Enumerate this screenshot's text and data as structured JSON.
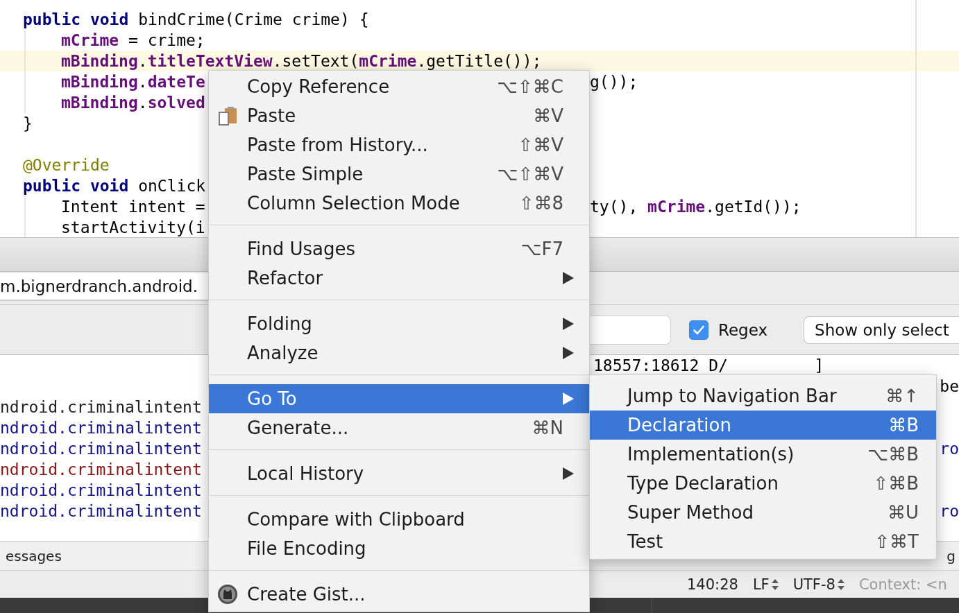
{
  "editor": {
    "blocks": [
      {
        "lines": [
          {
            "tokens": [
              {
                "kind": "keyword",
                "text": "public void",
                "suffix": " bindCrime(Crime crime) {"
              }
            ],
            "current": false,
            "children": [
              {
                "tokens": [
                  {
                    "kind": "field",
                    "text": "mCrime",
                    "suffix": " = crime;"
                  }
                ],
                "current": false
              },
              {
                "tokens": [
                  {
                    "kind": "field",
                    "text": "mBinding",
                    "suffix": "."
                  },
                  {
                    "kind": "field",
                    "text": "titleTextView",
                    "suffix": ".setText("
                  },
                  {
                    "kind": "field",
                    "text": "mCrime",
                    "suffix": ".getTitle());"
                  }
                ],
                "current": true
              },
              {
                "tokens": [
                  {
                    "kind": "field",
                    "text": "mBinding",
                    "suffix": "."
                  },
                  {
                    "kind": "field",
                    "text": "dateTe"
                  }
                ],
                "tokens_right": [
                  {
                    "kind": "plain",
                    "text": "g());"
                  }
                ],
                "current": false
              },
              {
                "tokens": [
                  {
                    "kind": "field",
                    "text": "mBinding",
                    "suffix": "."
                  },
                  {
                    "kind": "field",
                    "text": "solved"
                  }
                ],
                "current": false
              }
            ]
          },
          {
            "tokens": [
              {
                "kind": "plain",
                "text": "}"
              }
            ],
            "current": false
          }
        ]
      },
      {
        "lines": [
          {
            "tokens": [
              {
                "kind": "annotation",
                "text": "@Override"
              }
            ],
            "current": false
          },
          {
            "tokens": [
              {
                "kind": "keyword",
                "text": "public void",
                "suffix": " onClick"
              }
            ],
            "current": false,
            "children": [
              {
                "tokens": [
                  {
                    "kind": "plain",
                    "text": "Intent intent ="
                  }
                ],
                "tokens_right": [
                  {
                    "kind": "plain",
                    "text": "ty(), "
                  },
                  {
                    "kind": "field",
                    "text": "mCrime",
                    "suffix": ".getId());"
                  }
                ],
                "current": false
              },
              {
                "tokens": [
                  {
                    "kind": "plain",
                    "text": "startActivity(i"
                  }
                ],
                "current": false
              }
            ]
          }
        ]
      }
    ]
  },
  "monitor": {
    "process": "m.bignerdranch.android.",
    "regex": {
      "label": "Regex",
      "checked": true
    },
    "filter": "Show only select",
    "log_rows": [
      {
        "kind": "debug",
        "right_text": "18557:18612 D/         ]"
      },
      {
        "kind": "debug",
        "edge_text": "be"
      },
      {
        "kind": "info",
        "left_text": "ndroid.criminalintent"
      },
      {
        "kind": "warn",
        "left_text": "ndroid.criminalintent"
      },
      {
        "kind": "warn",
        "left_text": "ndroid.criminalintent",
        "edge_text": "ro"
      },
      {
        "kind": "error",
        "left_text": "ndroid.criminalintent"
      },
      {
        "kind": "warn",
        "left_text": "ndroid.criminalintent"
      },
      {
        "kind": "warn",
        "left_text": "ndroid.criminalintent",
        "edge_text": "ro"
      }
    ]
  },
  "tool_strip": {
    "left_label": "essages",
    "right_label": "g"
  },
  "status_bar": {
    "position": "140:28",
    "line_separator": "LF",
    "encoding": "UTF-8",
    "context": "Context: <n"
  },
  "context_menu": {
    "sections": [
      {
        "items": [
          {
            "label": "Copy Reference",
            "shortcut": "⌥⇧⌘C",
            "kind": "plain",
            "submenu": false,
            "selected": false
          },
          {
            "label": "Paste",
            "shortcut": "⌘V",
            "kind": "paste",
            "submenu": false,
            "selected": false
          },
          {
            "label": "Paste from History...",
            "shortcut": "⇧⌘V",
            "kind": "plain",
            "submenu": false,
            "selected": false
          },
          {
            "label": "Paste Simple",
            "shortcut": "⌥⇧⌘V",
            "kind": "plain",
            "submenu": false,
            "selected": false
          },
          {
            "label": "Column Selection Mode",
            "shortcut": "⇧⌘8",
            "kind": "plain",
            "submenu": false,
            "selected": false
          }
        ]
      },
      {
        "items": [
          {
            "label": "Find Usages",
            "shortcut": "⌥F7",
            "kind": "plain",
            "submenu": false,
            "selected": false
          },
          {
            "label": "Refactor",
            "kind": "plain",
            "submenu": true,
            "selected": false
          }
        ]
      },
      {
        "items": [
          {
            "label": "Folding",
            "kind": "plain",
            "submenu": true,
            "selected": false
          },
          {
            "label": "Analyze",
            "kind": "plain",
            "submenu": true,
            "selected": false
          }
        ]
      },
      {
        "items": [
          {
            "label": "Go To",
            "kind": "plain",
            "submenu": true,
            "selected": true,
            "children": [
              {
                "label": "Jump to Navigation Bar",
                "shortcut": "⌘↑",
                "selected": false
              },
              {
                "label": "Declaration",
                "shortcut": "⌘B",
                "selected": true
              },
              {
                "label": "Implementation(s)",
                "shortcut": "⌥⌘B",
                "selected": false
              },
              {
                "label": "Type Declaration",
                "shortcut": "⇧⌘B",
                "selected": false
              },
              {
                "label": "Super Method",
                "shortcut": "⌘U",
                "selected": false
              },
              {
                "label": "Test",
                "shortcut": "⇧⌘T",
                "selected": false
              }
            ]
          },
          {
            "label": "Generate...",
            "shortcut": "⌘N",
            "kind": "plain",
            "submenu": false,
            "selected": false
          }
        ]
      },
      {
        "items": [
          {
            "label": "Local History",
            "kind": "plain",
            "submenu": true,
            "selected": false
          }
        ]
      },
      {
        "items": [
          {
            "label": "Compare with Clipboard",
            "kind": "plain",
            "submenu": false,
            "selected": false
          },
          {
            "label": "File Encoding",
            "kind": "plain",
            "submenu": false,
            "selected": false
          }
        ]
      },
      {
        "items": [
          {
            "label": "Create Gist...",
            "kind": "gist",
            "submenu": false,
            "selected": false
          }
        ]
      }
    ]
  }
}
